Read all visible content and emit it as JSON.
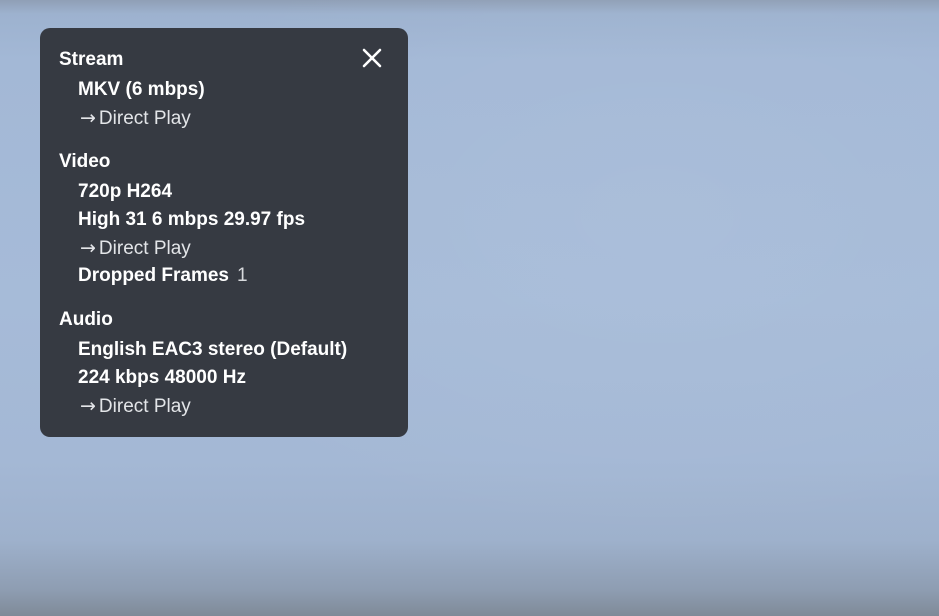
{
  "panel": {
    "close_label": "Close",
    "sections": {
      "stream": {
        "title": "Stream",
        "container": "MKV (6 mbps)",
        "mode": "Direct Play"
      },
      "video": {
        "title": "Video",
        "resolution": "720p H264",
        "details": "High 31 6 mbps 29.97 fps",
        "mode": "Direct Play",
        "dropped_frames_label": "Dropped Frames",
        "dropped_frames_value": "1"
      },
      "audio": {
        "title": "Audio",
        "track": "English EAC3 stereo (Default)",
        "details": "224 kbps 48000 Hz",
        "mode": "Direct Play"
      }
    }
  },
  "icons": {
    "close": "close-icon",
    "arrow": "arrow-right-icon"
  }
}
